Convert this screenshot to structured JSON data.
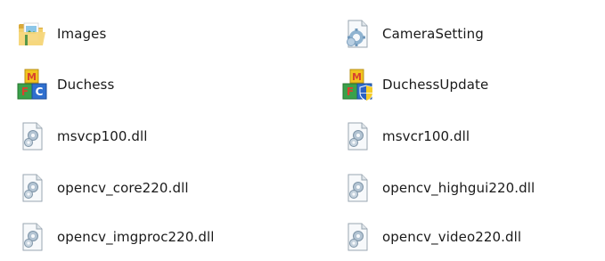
{
  "files": [
    {
      "name": "Images",
      "icon": "folder-icon"
    },
    {
      "name": "CameraSetting",
      "icon": "settings-file-icon"
    },
    {
      "name": "Duchess",
      "icon": "app-blocks-icon"
    },
    {
      "name": "DuchessUpdate",
      "icon": "app-blocks-shield-icon"
    },
    {
      "name": "msvcp100.dll",
      "icon": "dll-file-icon"
    },
    {
      "name": "msvcr100.dll",
      "icon": "dll-file-icon"
    },
    {
      "name": "opencv_core220.dll",
      "icon": "dll-file-icon"
    },
    {
      "name": "opencv_highgui220.dll",
      "icon": "dll-file-icon"
    },
    {
      "name": "opencv_imgproc220.dll",
      "icon": "dll-file-icon"
    },
    {
      "name": "opencv_video220.dll",
      "icon": "dll-file-icon"
    }
  ],
  "colors": {
    "folder": "#e9c256",
    "block_red": "#d8432e",
    "block_yellow": "#f1c31f",
    "block_green": "#3aa14a",
    "block_blue": "#2e6fcf",
    "shield_blue": "#2b61c4",
    "shield_yellow": "#f4cc2a"
  }
}
